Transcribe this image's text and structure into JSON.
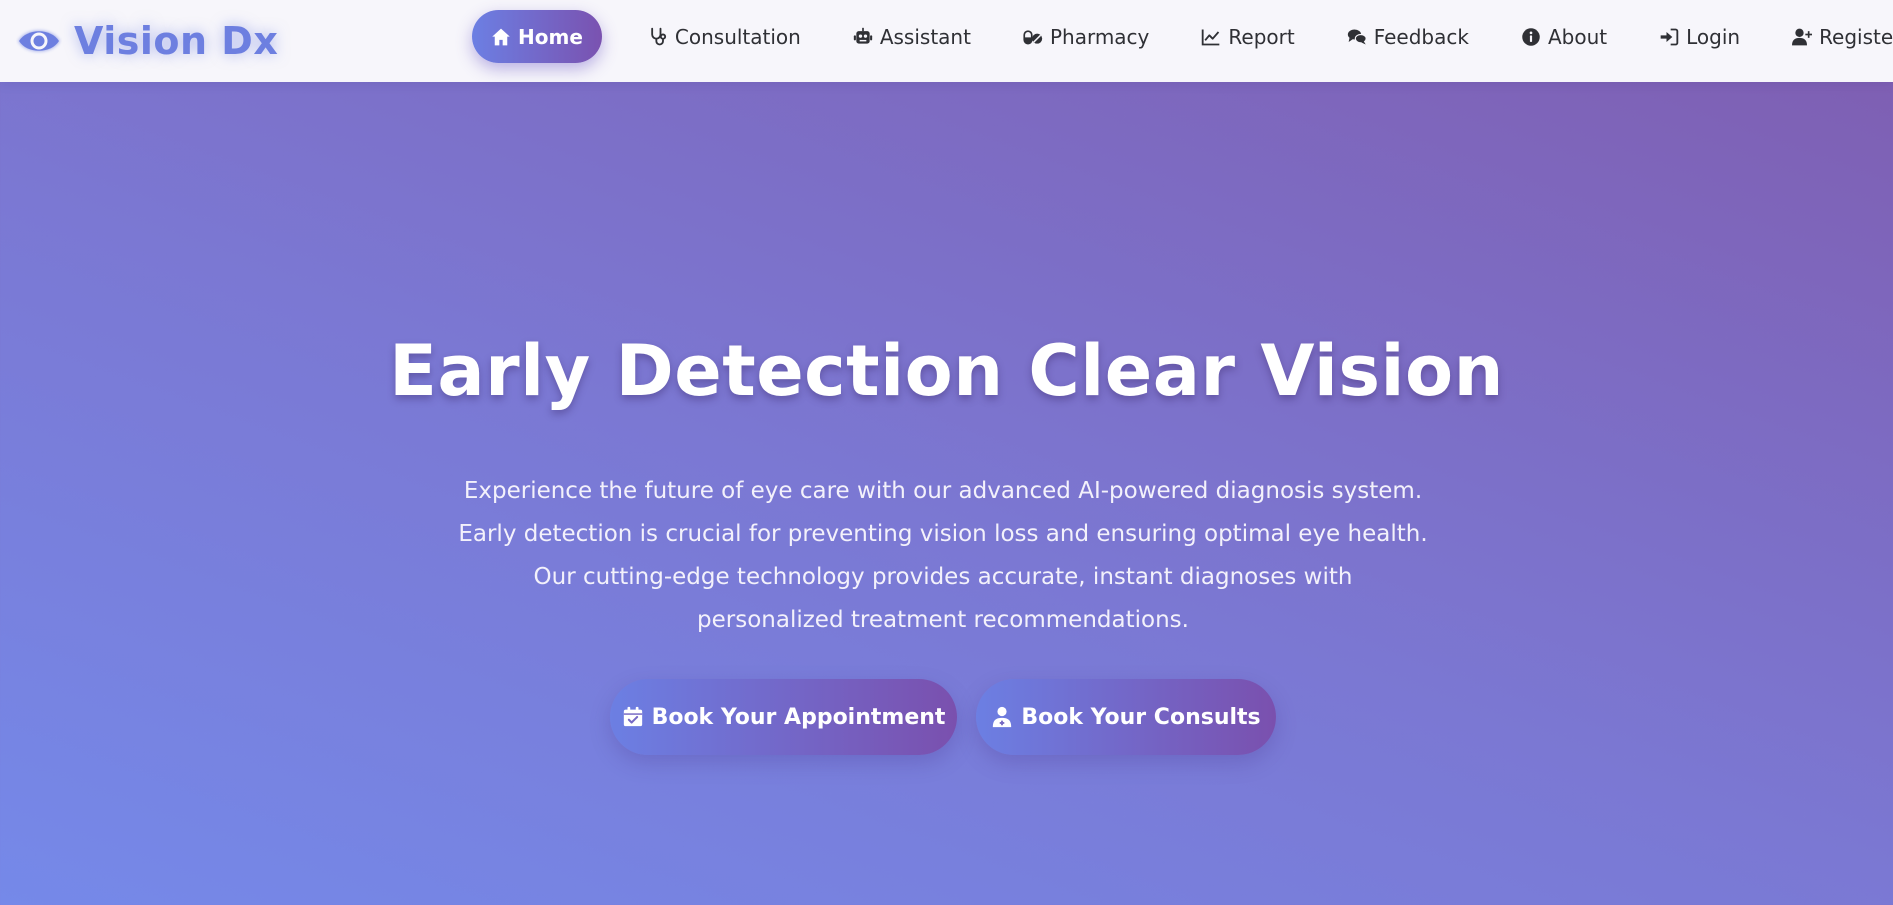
{
  "brand": {
    "name": "Vision Dx",
    "icon": "eye-icon",
    "color": "#6d7fe0"
  },
  "nav": {
    "items": [
      {
        "label": "Home",
        "icon": "home-icon",
        "active": true
      },
      {
        "label": "Consultation",
        "icon": "stethoscope-icon"
      },
      {
        "label": "Assistant",
        "icon": "robot-icon"
      },
      {
        "label": "Pharmacy",
        "icon": "pills-icon"
      },
      {
        "label": "Report",
        "icon": "chart-line-icon"
      },
      {
        "label": "Feedback",
        "icon": "comments-icon"
      },
      {
        "label": "About",
        "icon": "info-circle-icon"
      },
      {
        "label": "Login",
        "icon": "sign-in-icon"
      },
      {
        "label": "Register",
        "icon": "user-plus-icon"
      }
    ]
  },
  "hero": {
    "title": "Early Detection Clear Vision",
    "description": "Experience the future of eye care with our advanced AI-powered diagnosis system. Early detection is crucial for preventing vision loss and ensuring optimal eye health. Our cutting-edge technology provides accurate, instant diagnoses with personalized treatment recommendations.",
    "buttons": {
      "appointment": {
        "label": "Book Your Appointment",
        "icon": "calendar-check-icon"
      },
      "consults": {
        "label": "Book Your Consults",
        "icon": "user-doctor-icon"
      }
    }
  },
  "colors": {
    "accent_start": "#6c7fe3",
    "accent_end": "#7a50ae",
    "navbar_bg": "#f7f6fb",
    "hero_bg_start": "#7589e9",
    "hero_bg_end": "#7f5db0"
  }
}
